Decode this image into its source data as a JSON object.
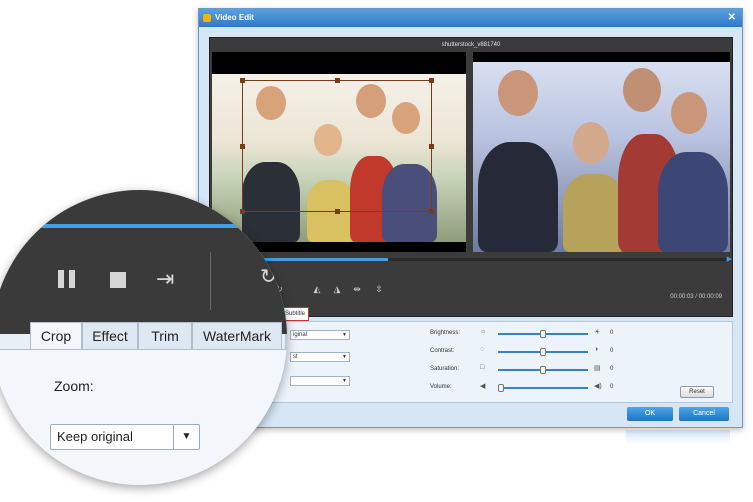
{
  "window": {
    "title": "Video Edit",
    "file_name": "shutterstock_v881740"
  },
  "player": {
    "time_readout": "00:00:03 / 00:00:09"
  },
  "tabs": {
    "crop": "Crop",
    "effect": "Effect",
    "trim": "Trim",
    "watermark": "WaterMark",
    "watermark_partial": "aterMark",
    "subtitle": "Subtitle"
  },
  "crop_panel": {
    "zoom_label": "Zoom:",
    "zoom_value": "Keep original",
    "small_select_1": "iginal",
    "small_select_2": "st",
    "small_select_3": ""
  },
  "adjust": [
    {
      "label": "Brightness:",
      "value": "0",
      "level": 0.5
    },
    {
      "label": "Contrast:",
      "value": "0",
      "level": 0.5
    },
    {
      "label": "Saturation:",
      "value": "0",
      "level": 0.5
    },
    {
      "label": "Volume:",
      "value": "0",
      "level": 0.0
    }
  ],
  "buttons": {
    "reset": "Reset",
    "ok": "OK",
    "cancel": "Cancel"
  },
  "colors": {
    "accent": "#3f9fe8",
    "titlebar": "#2f78c6"
  }
}
